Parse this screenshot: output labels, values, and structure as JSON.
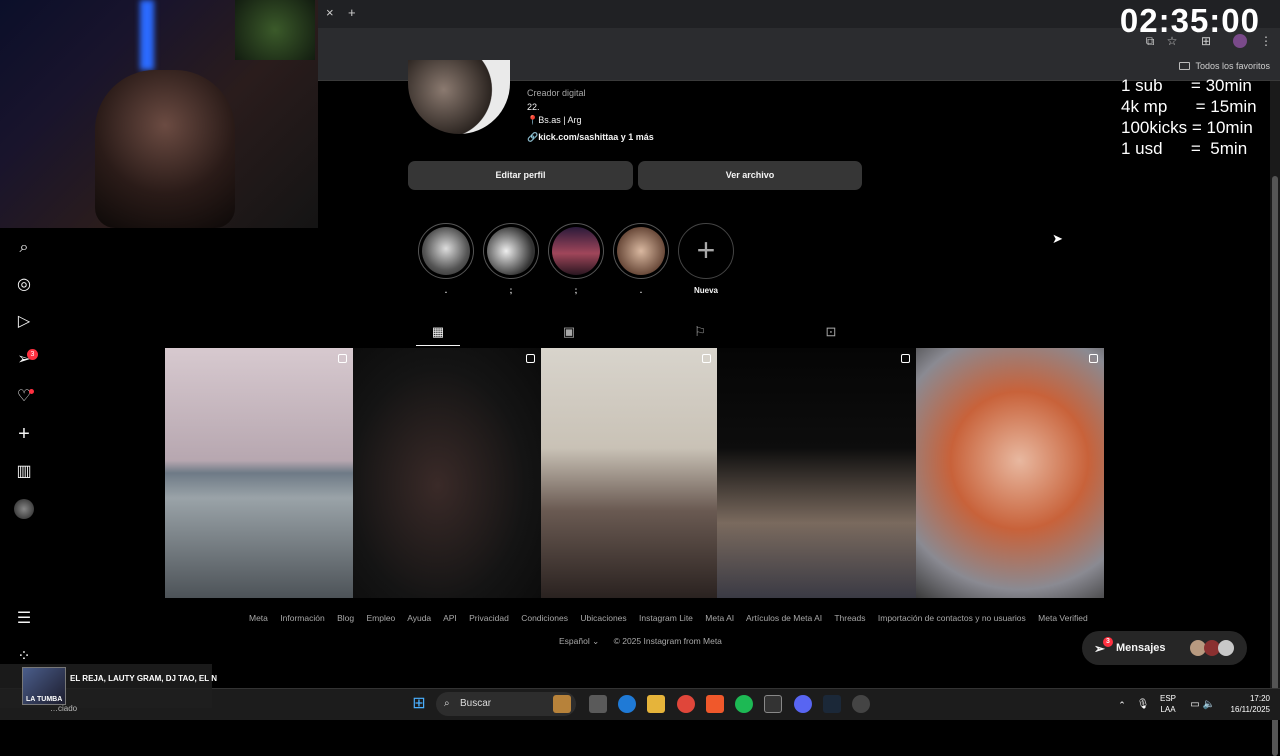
{
  "browser": {
    "tab_close": "×",
    "new_tab": "+",
    "bookmarks_label": "Todos los favoritos"
  },
  "stream": {
    "timer": "02:35:00",
    "rules": [
      "1 sub      = 30min",
      "4k mp      = 15min",
      "100kicks = 10min",
      "1 usd      =  5min"
    ]
  },
  "sidebar": {
    "notifications_badge": "3"
  },
  "profile": {
    "category": "Creador digital",
    "age": "22.",
    "location": "📍Bs.as | Arg",
    "link": "kick.com/sashittaa y 1 más",
    "edit_button": "Editar perfil",
    "archive_button": "Ver archivo"
  },
  "highlights": [
    {
      "label": ".",
      "color": "#9a9a9a"
    },
    {
      "label": ";",
      "color": "#c9c2bb"
    },
    {
      "label": ";",
      "color": "#a0465a"
    },
    {
      "label": ".",
      "color": "#b58a6a"
    },
    {
      "label": "Nueva",
      "color": "#000000"
    }
  ],
  "footer": {
    "links": [
      "Meta",
      "Información",
      "Blog",
      "Empleo",
      "Ayuda",
      "API",
      "Privacidad",
      "Condiciones",
      "Ubicaciones",
      "Instagram Lite",
      "Meta AI",
      "Artículos de Meta AI",
      "Threads",
      "Importación de contactos y no usuarios",
      "Meta Verified"
    ],
    "language": "Español",
    "copyright": "© 2025 Instagram from Meta"
  },
  "messages": {
    "label": "Mensajes",
    "badge": "3"
  },
  "music": {
    "title": "EL REJA, LAUTY GRAM, DJ TAO, EL N",
    "source": "LA TUMBA",
    "status": "…ciado"
  },
  "taskbar": {
    "search_placeholder": "Buscar",
    "lang_top": "ESP",
    "lang_bottom": "LAA",
    "time": "17:20",
    "date": "16/11/2025"
  }
}
